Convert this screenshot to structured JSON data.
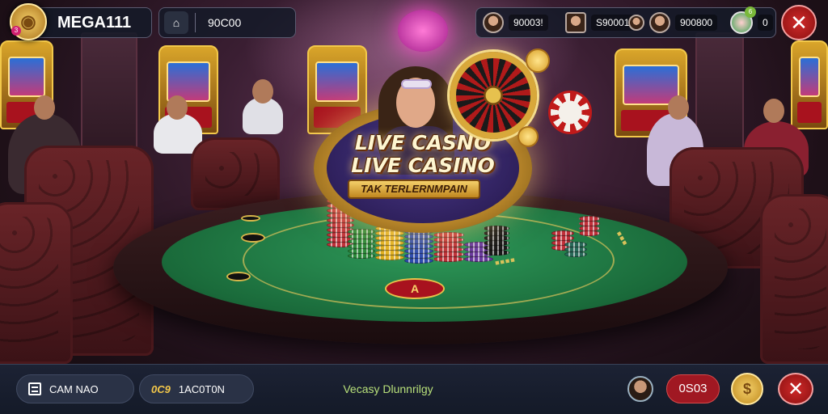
{
  "topbar": {
    "brand": "MEGA111",
    "logo_badge": "3",
    "balance": "90C00",
    "players": [
      {
        "amount": "90003!"
      },
      {
        "amount": "S90001"
      },
      {
        "amount": "900800"
      },
      {
        "amount": "0"
      }
    ],
    "trophy_badge": "6"
  },
  "hero": {
    "line1": "LIVE CASNO",
    "line2": "LIVE CASINO",
    "ribbon": "TAK TERLERNMPAIN",
    "table_spot": "A"
  },
  "bottombar": {
    "category": "CAM NAO",
    "rate_prefix": "0C9",
    "rate_label": "1AC0T0N",
    "center_text": "Vecasy Dlunnrilgy",
    "chip_count": "0S03"
  },
  "colors": {
    "accent_gold": "#f4c84a",
    "close_red": "#d02a2a",
    "felt_green": "#2e9a5a"
  },
  "icons": {
    "home": "home-icon",
    "menu": "menu-list-icon",
    "coin_bag": "coin-bag-icon",
    "close": "close-icon"
  }
}
